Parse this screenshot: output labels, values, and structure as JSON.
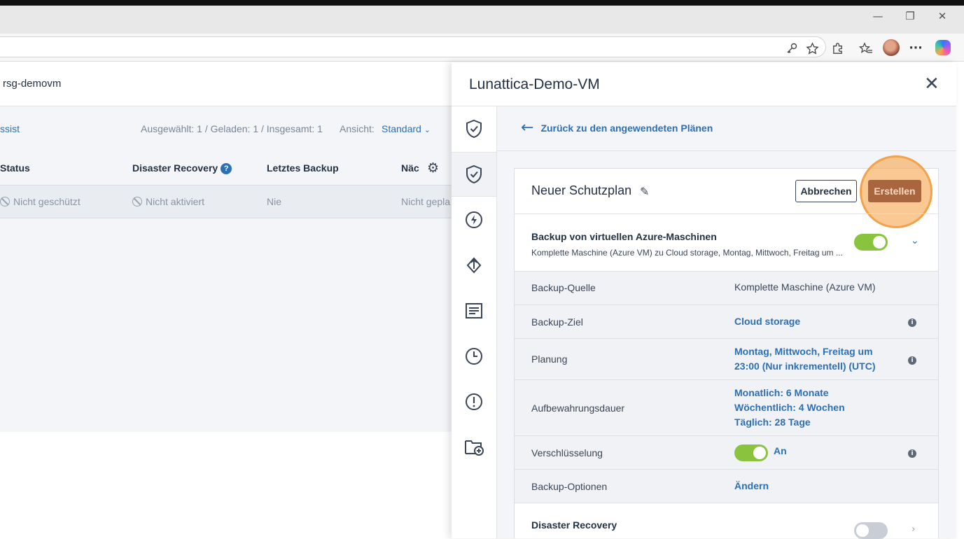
{
  "browser": {
    "window_controls": {
      "minimize": "—",
      "restore": "❐",
      "close": "✕"
    },
    "toolbar_icons": [
      "key-icon",
      "star-icon",
      "extensions-icon",
      "favorites-icon",
      "profile-avatar",
      "more-icon",
      "copilot-icon"
    ],
    "more_label": "···"
  },
  "background": {
    "title": "rsg-demovm",
    "assist_link": "ssist",
    "counts": "Ausgewählt: 1 / Geladen: 1 / Insgesamt: 1",
    "view_label": "Ansicht:",
    "view_value": "Standard",
    "columns": [
      "Status",
      "Disaster Recovery",
      "Letztes Backup",
      "Näc"
    ],
    "help_glyph": "?",
    "row": {
      "status": "Nicht geschützt",
      "disaster_recovery": "Nicht aktiviert",
      "last_backup": "Nie",
      "next": "Nicht gepla"
    }
  },
  "panel": {
    "title": "Lunattica-Demo-VM",
    "back_label": "Zurück zu den angewendeten Plänen",
    "rail_icons": [
      "shield-check-icon",
      "shield-check-active-icon",
      "lightning-icon",
      "transfer-icon",
      "report-icon",
      "clock-icon",
      "alert-icon",
      "folder-add-icon"
    ],
    "plan": {
      "name": "Neuer Schutzplan",
      "cancel_label": "Abbrechen",
      "create_label": "Erstellen",
      "section_title": "Backup von virtuellen Azure-Maschinen",
      "section_subtitle": "Komplette Maschine (Azure VM) zu Cloud storage, Montag, Mittwoch, Freitag um ...",
      "section_enabled": true,
      "rows": [
        {
          "label": "Backup-Quelle",
          "value": "Komplette Maschine (Azure VM)"
        },
        {
          "label": "Backup-Ziel",
          "value": "Cloud storage"
        },
        {
          "label": "Planung",
          "value_line1": "Montag, Mittwoch, Freitag um",
          "value_line2": "23:00 (Nur inkrementell) (UTC)"
        },
        {
          "label": "Aufbewahrungsdauer",
          "value_line1": "Monatlich: 6 Monate",
          "value_line2": "Wöchentlich: 4 Wochen",
          "value_line3": "Täglich: 28 Tage"
        },
        {
          "label": "Verschlüsselung",
          "value": "An",
          "enabled": true
        },
        {
          "label": "Backup-Optionen",
          "value": "Ändern"
        }
      ],
      "disaster_recovery": {
        "title": "Disaster Recovery",
        "enabled": false
      }
    }
  },
  "colors": {
    "accent_blue": "#2d6fb5",
    "toggle_on": "#8ac43f",
    "create_button": "#a9653d",
    "highlight": "#f4a24a"
  }
}
